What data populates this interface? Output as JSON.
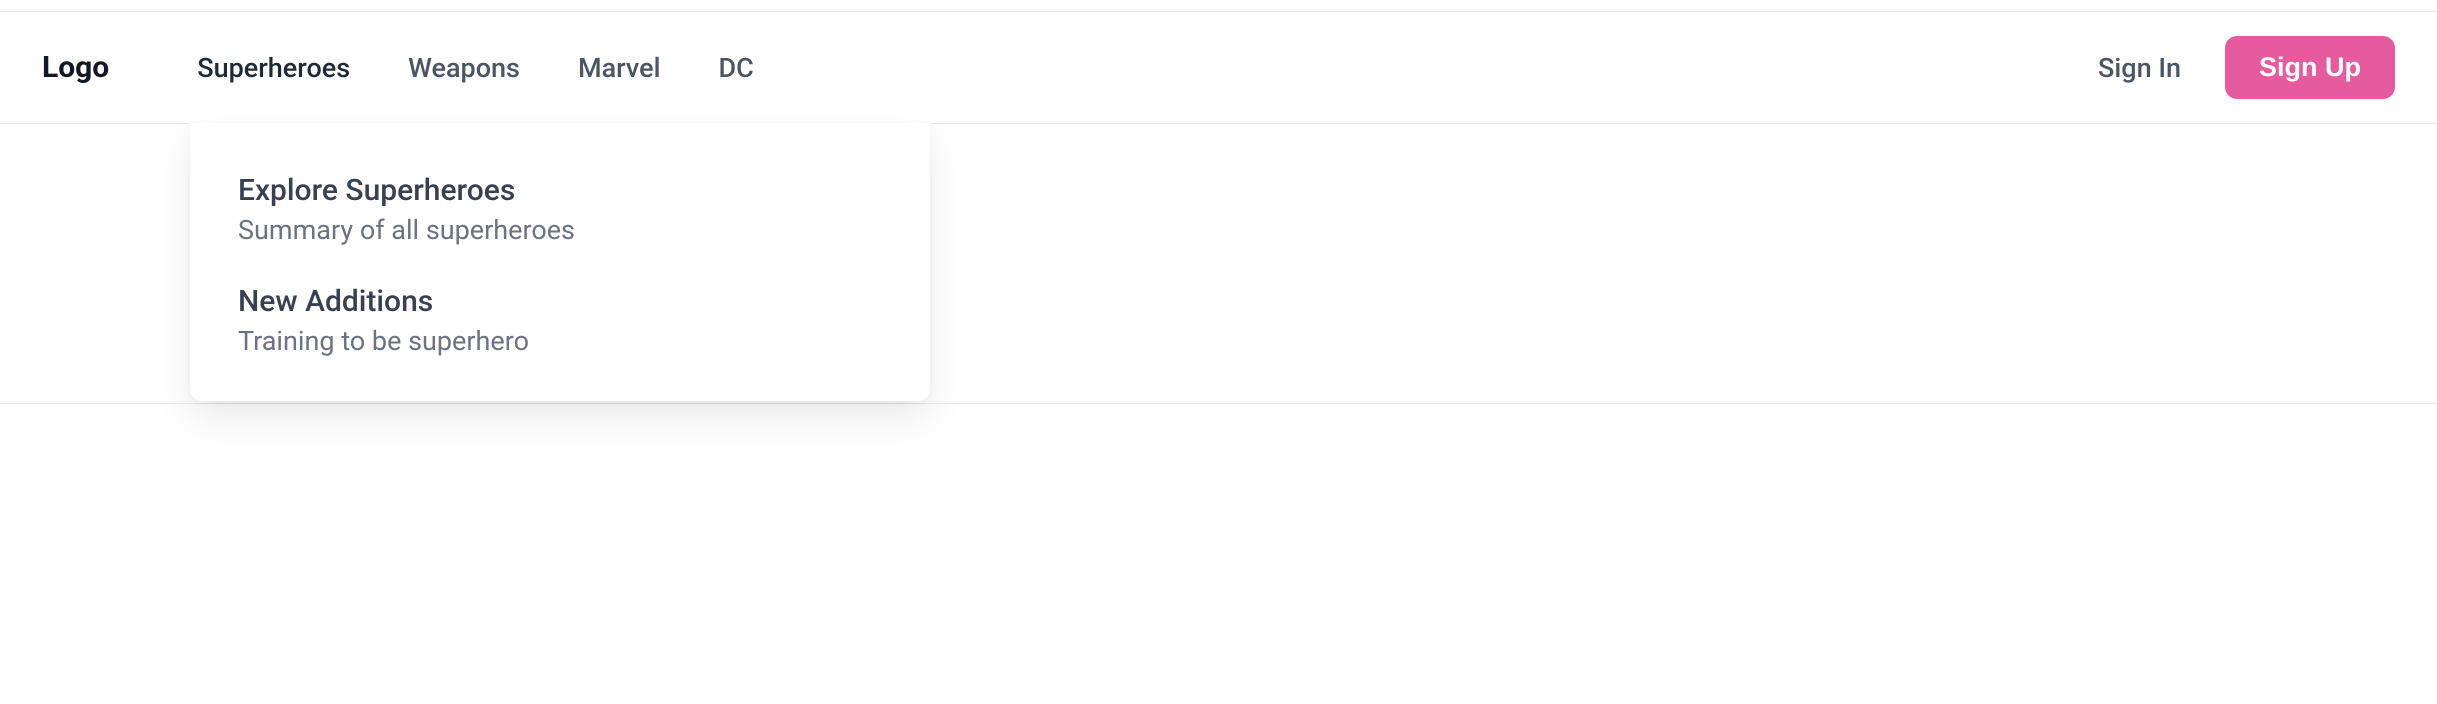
{
  "logo": "Logo",
  "nav": {
    "items": [
      {
        "label": "Superheroes",
        "active": true
      },
      {
        "label": "Weapons",
        "active": false
      },
      {
        "label": "Marvel",
        "active": false
      },
      {
        "label": "DC",
        "active": false
      }
    ]
  },
  "auth": {
    "signin_label": "Sign In",
    "signup_label": "Sign Up"
  },
  "dropdown": {
    "items": [
      {
        "title": "Explore Superheroes",
        "description": "Summary of all superheroes"
      },
      {
        "title": "New Additions",
        "description": "Training to be superhero"
      }
    ]
  }
}
